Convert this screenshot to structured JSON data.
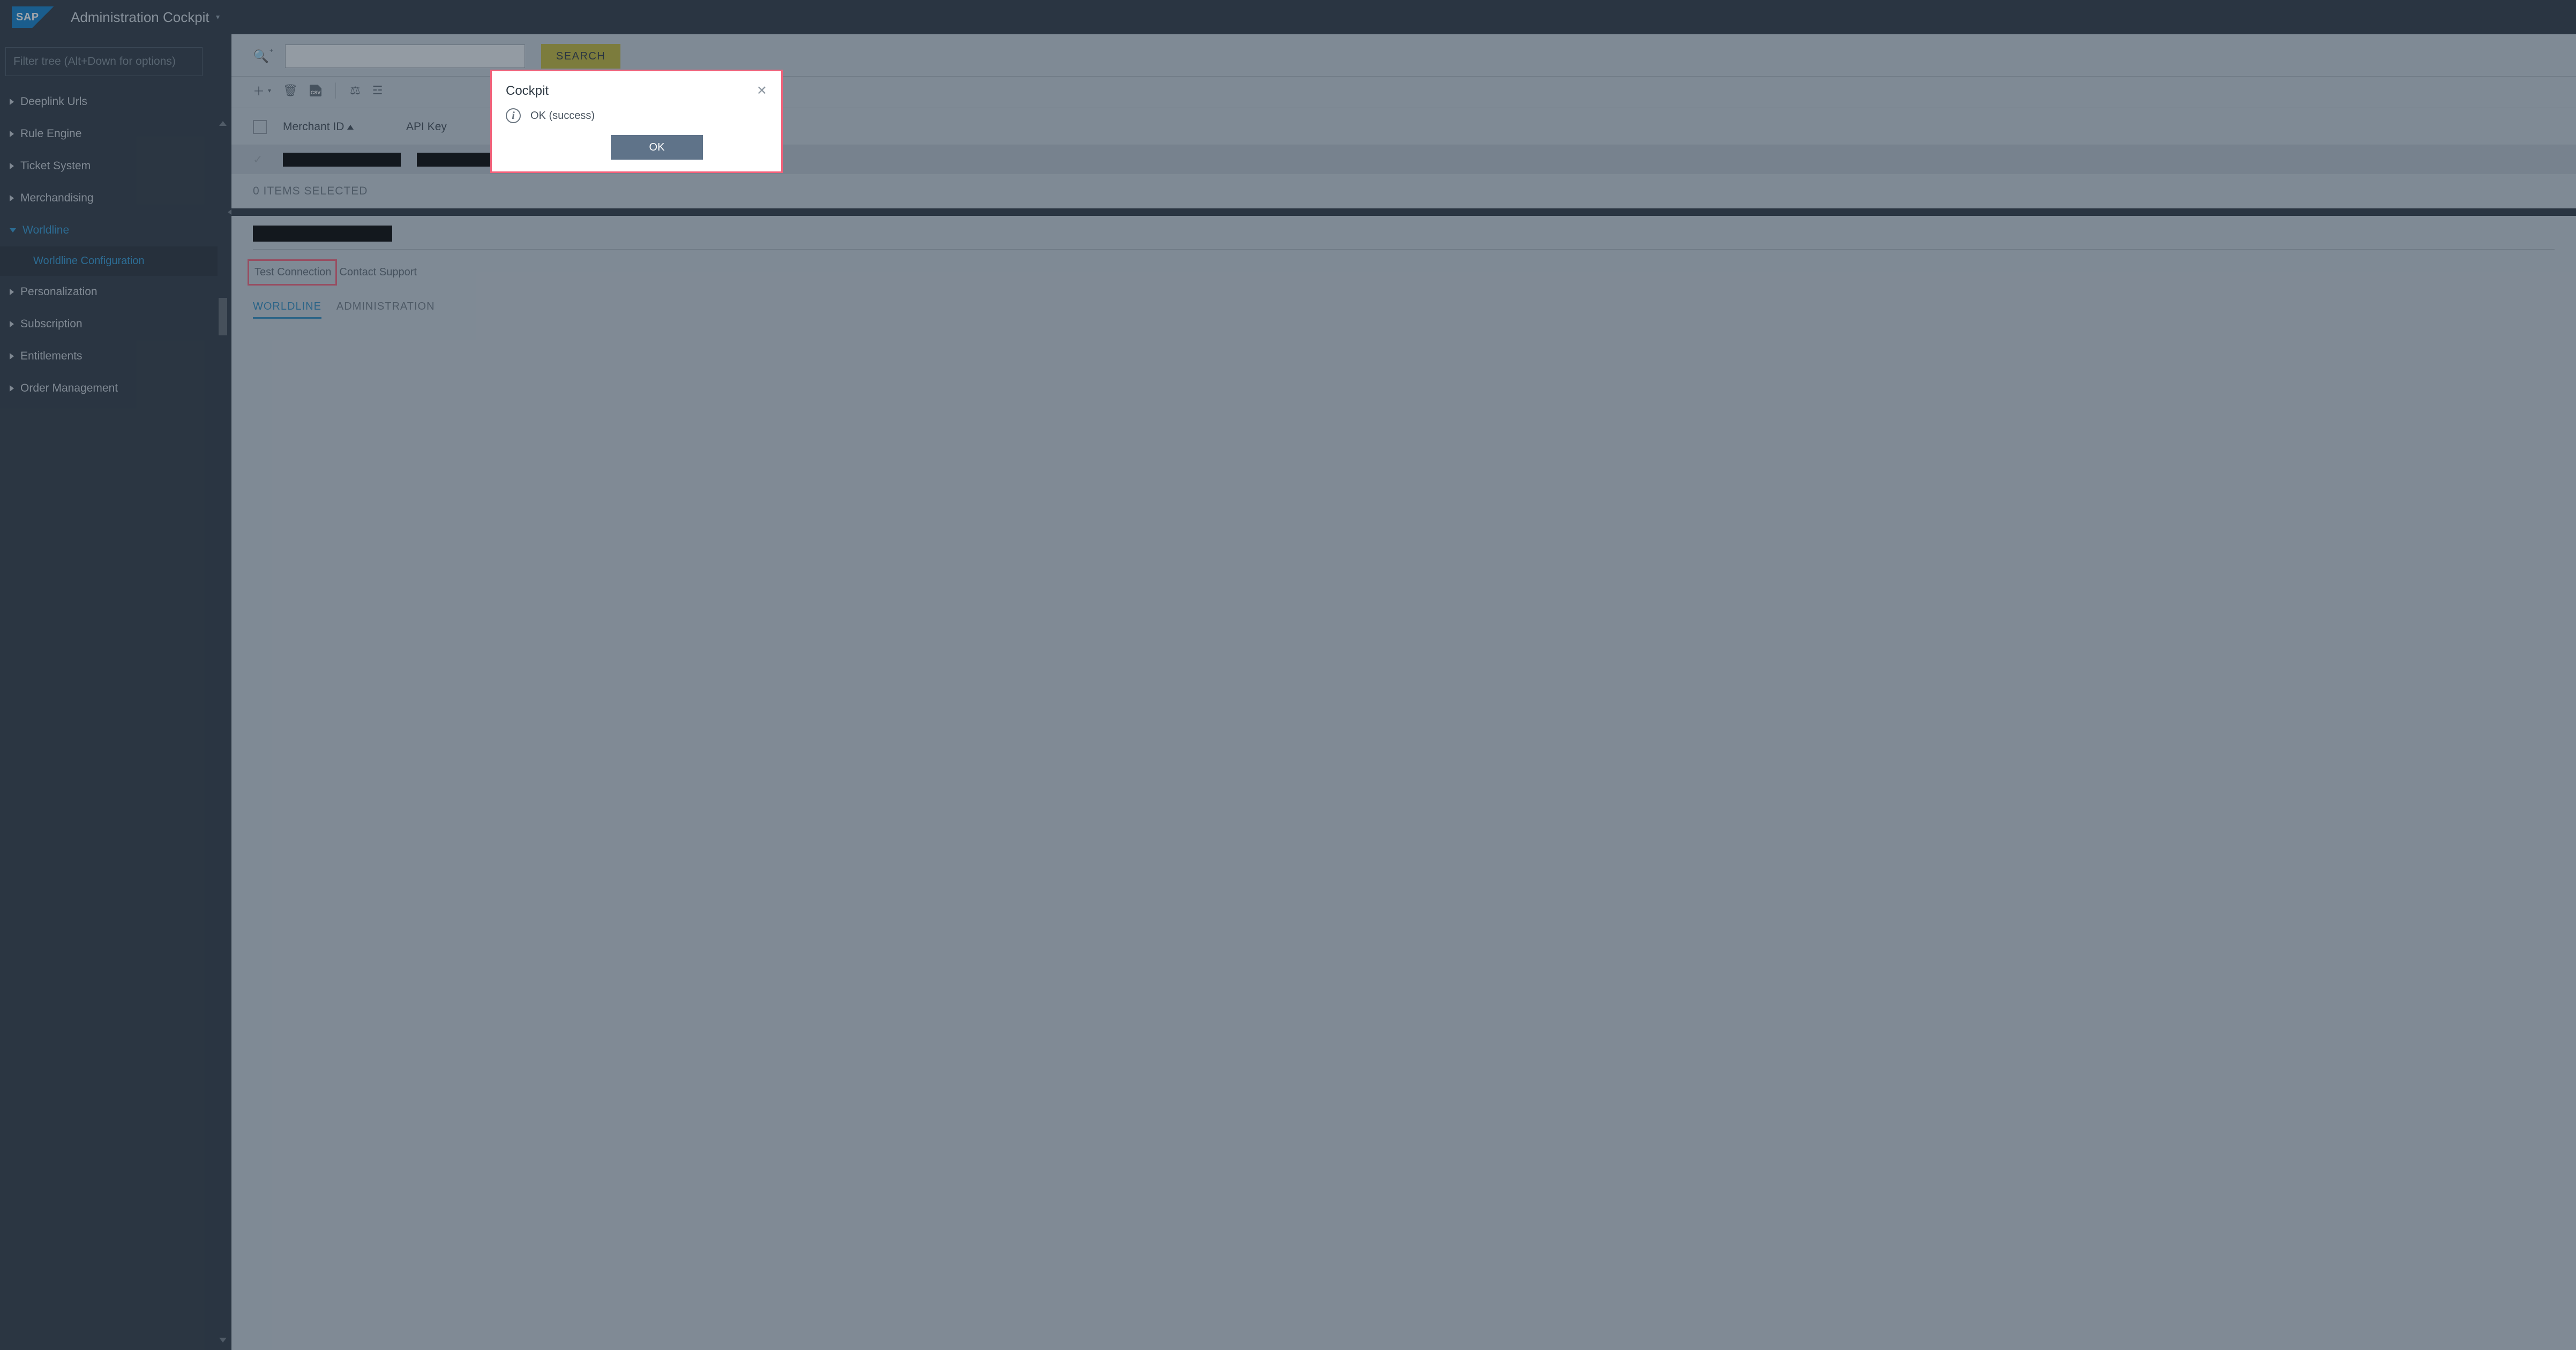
{
  "header": {
    "logo_text": "SAP",
    "title": "Administration Cockpit"
  },
  "sidebar": {
    "filter_placeholder": "Filter tree (Alt+Down for options)",
    "items": [
      {
        "label": "Deeplink Urls",
        "expanded": false
      },
      {
        "label": "Rule Engine",
        "expanded": false
      },
      {
        "label": "Ticket System",
        "expanded": false
      },
      {
        "label": "Merchandising",
        "expanded": false
      },
      {
        "label": "Worldline",
        "expanded": true,
        "active": true,
        "children": [
          {
            "label": "Worldline Configuration",
            "active": true
          }
        ]
      },
      {
        "label": "Personalization",
        "expanded": false
      },
      {
        "label": "Subscription",
        "expanded": false
      },
      {
        "label": "Entitlements",
        "expanded": false
      },
      {
        "label": "Order Management",
        "expanded": false
      }
    ]
  },
  "search": {
    "button": "SEARCH"
  },
  "toolbar": {
    "add_dropdown": "▾",
    "csv_label": "CSV"
  },
  "table": {
    "columns": {
      "merchant_id": "Merchant ID",
      "api_key": "API Key"
    },
    "status": "0 ITEMS SELECTED"
  },
  "detail": {
    "test_connection": "Test Connection",
    "contact_support": "Contact Support",
    "tabs": {
      "worldline": "WORLDLINE",
      "administration": "ADMINISTRATION"
    }
  },
  "modal": {
    "title": "Cockpit",
    "message": "OK (success)",
    "ok": "OK"
  }
}
